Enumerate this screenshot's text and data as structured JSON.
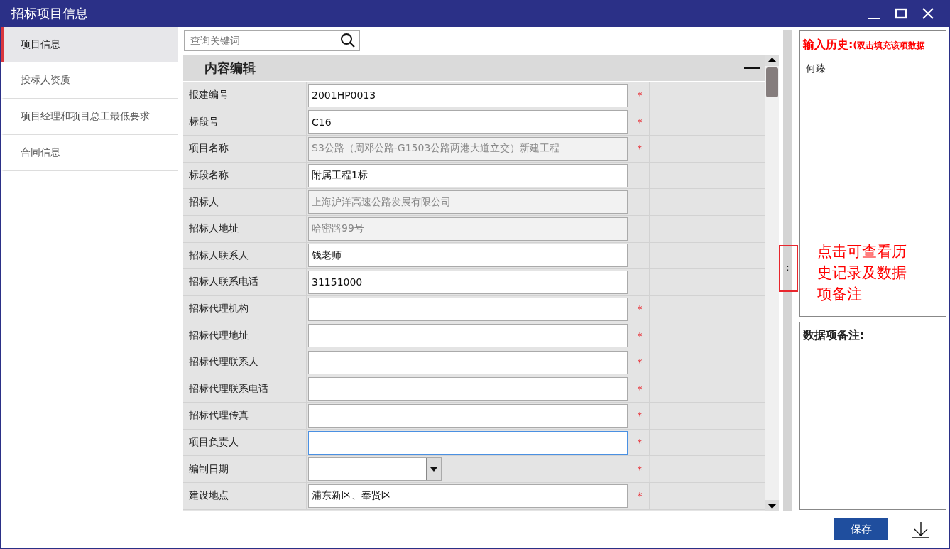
{
  "window": {
    "title": "招标项目信息"
  },
  "sidebar": {
    "items": [
      {
        "label": "项目信息",
        "selected": true
      },
      {
        "label": "投标人资质",
        "selected": false
      },
      {
        "label": "项目经理和项目总工最低要求",
        "selected": false
      },
      {
        "label": "合同信息",
        "selected": false
      }
    ]
  },
  "search": {
    "placeholder": "查询关键词"
  },
  "section": {
    "title": "内容编辑"
  },
  "fields": [
    {
      "label": "报建编号",
      "value": "2001HP0013",
      "kind": "text",
      "required": true,
      "focused": false
    },
    {
      "label": "标段号",
      "value": "C16",
      "kind": "text",
      "required": true,
      "focused": false
    },
    {
      "label": "项目名称",
      "value": "S3公路（周邓公路-G1503公路两港大道立交）新建工程",
      "kind": "readonly",
      "required": true,
      "focused": false
    },
    {
      "label": "标段名称",
      "value": "附属工程1标",
      "kind": "text",
      "required": false,
      "focused": false
    },
    {
      "label": "招标人",
      "value": "上海沪洋高速公路发展有限公司",
      "kind": "readonly",
      "required": false,
      "focused": false
    },
    {
      "label": "招标人地址",
      "value": "哈密路99号",
      "kind": "readonly",
      "required": false,
      "focused": false
    },
    {
      "label": "招标人联系人",
      "value": "钱老师",
      "kind": "text",
      "required": false,
      "focused": false
    },
    {
      "label": "招标人联系电话",
      "value": "31151000",
      "kind": "text",
      "required": false,
      "focused": false
    },
    {
      "label": "招标代理机构",
      "kind": "text",
      "required": true,
      "focused": false
    },
    {
      "label": "招标代理地址",
      "kind": "text",
      "required": true,
      "focused": false
    },
    {
      "label": "招标代理联系人",
      "kind": "text",
      "required": true,
      "focused": false
    },
    {
      "label": "招标代理联系电话",
      "kind": "text",
      "required": true,
      "focused": false
    },
    {
      "label": "招标代理传真",
      "kind": "text",
      "required": true,
      "focused": false
    },
    {
      "label": "项目负责人",
      "kind": "text",
      "required": true,
      "focused": true
    },
    {
      "label": "编制日期",
      "kind": "date",
      "required": true,
      "focused": false
    },
    {
      "label": "建设地点",
      "value": "浦东新区、奉贤区",
      "kind": "text",
      "required": true,
      "focused": false
    }
  ],
  "required_mark": "*",
  "splitter": {
    "handle": ":"
  },
  "history": {
    "title": "输入历史:",
    "hint": "(双击填充该项数据",
    "entries": [
      "何臻"
    ]
  },
  "notes": {
    "title": "数据项备注:"
  },
  "annotation": {
    "text": "点击可查看历史记录及数据项备注"
  },
  "buttons": {
    "save": "保存"
  }
}
